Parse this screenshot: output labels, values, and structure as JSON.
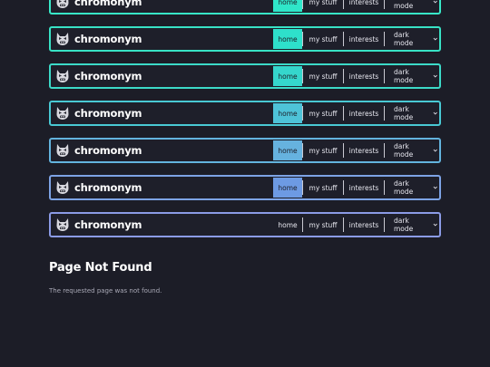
{
  "brand": {
    "name": "chromonym"
  },
  "nav": {
    "home": "home",
    "stuff": "my stuff",
    "interests": "interests",
    "mode": "dark mode"
  },
  "variants": [
    {
      "border": "#38e9c8",
      "active": "#2fe6c9"
    },
    {
      "border": "#38e2c5",
      "active": "#2ee0cb"
    },
    {
      "border": "#3cdac8",
      "active": "#35d6cc"
    },
    {
      "border": "#49c9d4",
      "active": "#4ec3d8"
    },
    {
      "border": "#63b4de",
      "active": "#66b2df"
    },
    {
      "border": "#7da3e5",
      "active": "#6d9ae3"
    },
    {
      "border": "#8b9be6",
      "active": ""
    }
  ],
  "page": {
    "title": "Page Not Found",
    "message": "The requested page was not found."
  }
}
